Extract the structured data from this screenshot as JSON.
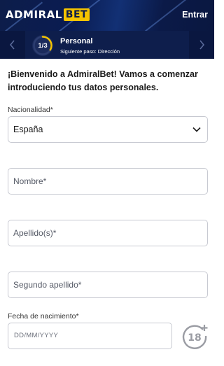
{
  "header": {
    "logo_main": "ADMIRAL",
    "logo_accent": "BET",
    "login_label": "Entrar"
  },
  "stepper": {
    "step_counter": "1/3",
    "progress_fraction": 0.3333,
    "title": "Personal",
    "next_step": "Siguiente paso: Dirección"
  },
  "form": {
    "welcome": "¡Bienvenido a AdmiralBet! Vamos a comenzar introduciendo tus datos personales.",
    "nationality_label": "Nacionalidad*",
    "nationality_value": "España",
    "name_placeholder": "Nombre*",
    "surname_placeholder": "Apellido(s)*",
    "second_surname_placeholder": "Segundo apellido*",
    "birthdate_label": "Fecha de nacimiento*",
    "birthdate_placeholder": "DD/MM/YYYY"
  },
  "icons": {
    "age_badge": "18-plus-icon",
    "age_badge_text": "18"
  },
  "colors": {
    "header_bg": "#0d1d4a",
    "brand_yellow": "#f5c400",
    "input_border": "#c7c9d1"
  }
}
